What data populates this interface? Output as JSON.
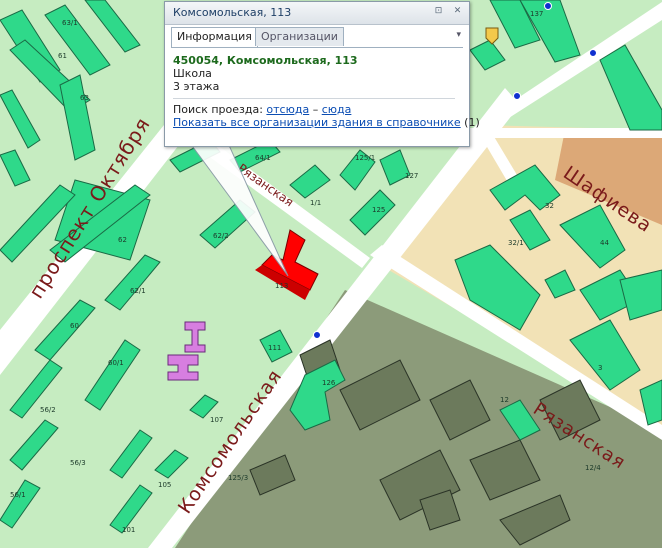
{
  "popup": {
    "title": "Комсомольская, 113",
    "tabs": [
      "Информация",
      "Организации"
    ],
    "address": "450054, Комсомольская, 113",
    "type": "Школа",
    "floors": "3 этажа",
    "route_label": "Поиск проезда:",
    "route_from": "отсюда",
    "route_dash": "–",
    "route_to": "сюда",
    "show_all_link": "Показать все организации здания в справочнике",
    "show_all_count": "(1)"
  },
  "map": {
    "streets": {
      "prospekt": "проспект Октября",
      "komsomolskaya": "Комсомольская",
      "ryazanskaya_nw": "Рязанская",
      "ryazanskaya_se": "Рязанская",
      "shafieva": "Шафиева"
    },
    "house_numbers": [
      "63/1",
      "63",
      "61",
      "64/1",
      "125/1",
      "127",
      "1/1",
      "125",
      "62/2",
      "62",
      "113",
      "62/1",
      "60",
      "60/1",
      "111",
      "56/2",
      "56/3",
      "107",
      "56/1",
      "105",
      "125/3",
      "101",
      "126",
      "12",
      "32",
      "32/1",
      "44",
      "3",
      "137",
      "12/4"
    ],
    "colors": {
      "park": "#c6ecc1",
      "building": "#2fd98a",
      "selected_building": "#ff0000",
      "school_annex": "#d77ee0",
      "industrial_zone": "#8a9a78",
      "residential_zone": "#f3e4b8",
      "street_label": "#7a1a1a",
      "bus_stop": "#1030d0"
    }
  }
}
